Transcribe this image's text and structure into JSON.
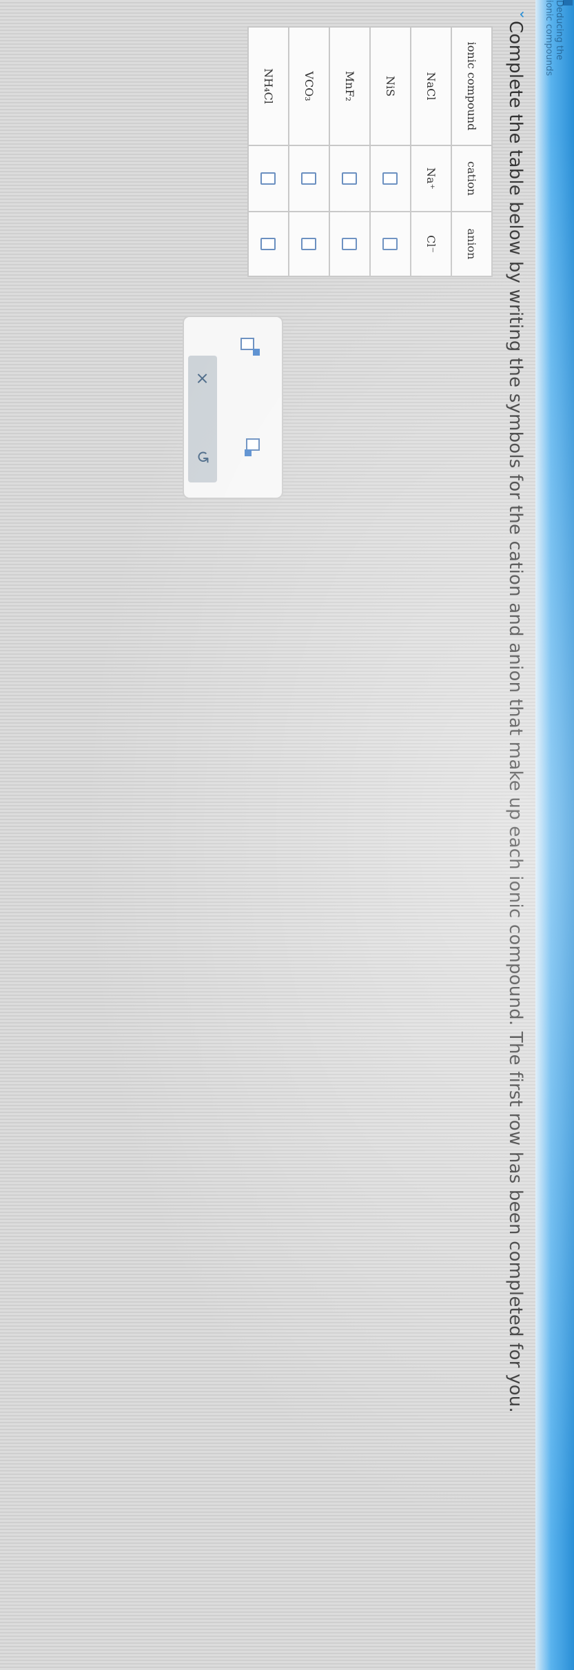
{
  "header": {
    "title": "Deducing the ionic compounds",
    "collapse_icon": "chevron-down-icon"
  },
  "instruction": "Complete the table below by writing the symbols for the cation and anion that make up each ionic compound. The first row has been completed for you.",
  "table": {
    "headers": [
      "ionic compound",
      "cation",
      "anion"
    ],
    "rows": [
      {
        "compound": "NaCl",
        "cation": "Na⁺",
        "anion": "Cl⁻"
      },
      {
        "compound": "NiS",
        "cation": "",
        "anion": ""
      },
      {
        "compound": "MnF₂",
        "cation": "",
        "anion": ""
      },
      {
        "compound": "VCO₃",
        "cation": "",
        "anion": ""
      },
      {
        "compound": "NH₄Cl",
        "cation": "",
        "anion": ""
      }
    ]
  },
  "toolbox": {
    "superscript_icon": "superscript-icon",
    "subscript_icon": "subscript-icon",
    "clear_label": "×",
    "undo_label": "↺"
  },
  "colors": {
    "accent": "#2a8fd6",
    "answer_box": "#6a8fc0",
    "button_bar": "#cdd3d8"
  }
}
